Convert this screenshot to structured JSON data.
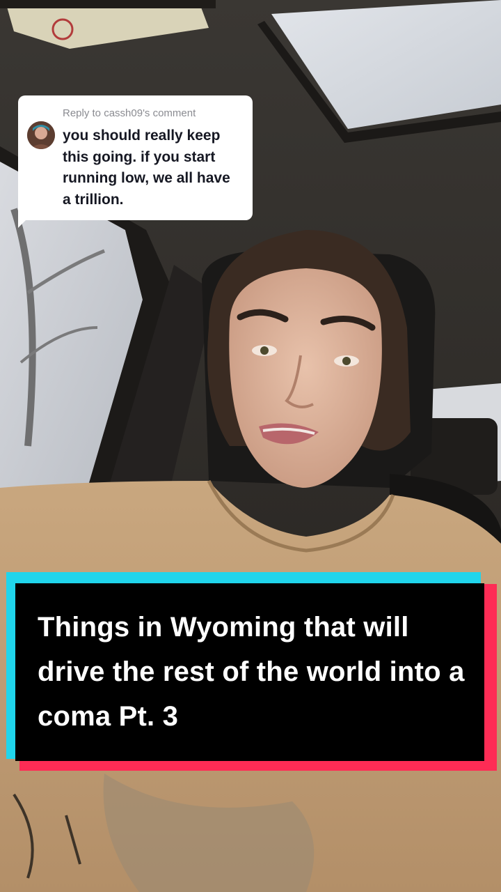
{
  "reply": {
    "header": "Reply to cassh09's comment",
    "text": "you should really keep this going. if you start running low, we all have a trillion."
  },
  "caption": {
    "text": "Things in Wyoming that will drive the rest of the world into a coma Pt. 3"
  },
  "colors": {
    "caption_bg": "#000000",
    "caption_cyan": "#20d5ec",
    "caption_red": "#fe2c55",
    "bubble_bg": "#ffffff",
    "bubble_header": "#8a8b91",
    "bubble_text": "#161823"
  }
}
